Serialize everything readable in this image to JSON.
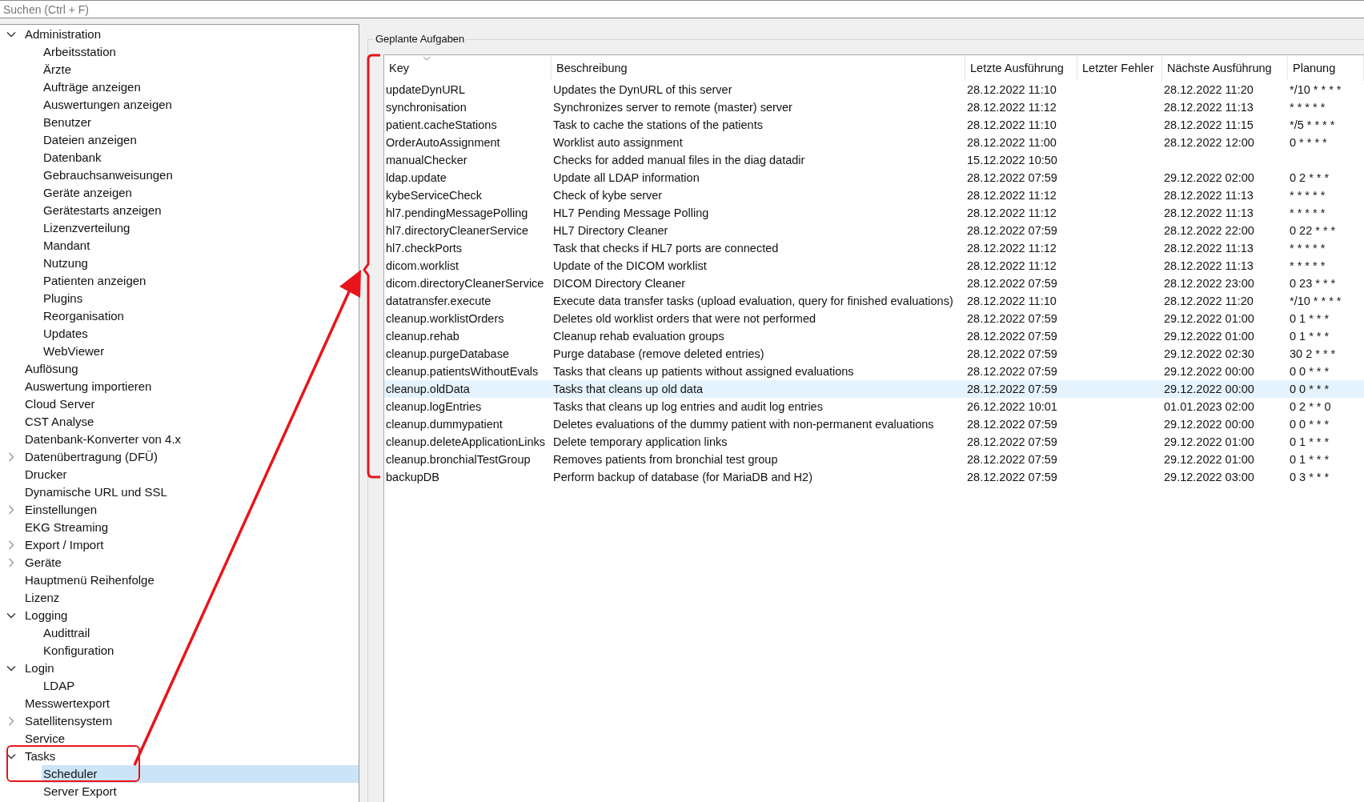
{
  "search": {
    "placeholder": "Suchen (Ctrl + F)"
  },
  "tree": [
    {
      "label": "Administration",
      "expanded": true,
      "selected": false,
      "children": [
        {
          "label": "Arbeitsstation",
          "selected": false
        },
        {
          "label": "Ärzte",
          "selected": false
        },
        {
          "label": "Aufträge anzeigen",
          "selected": false
        },
        {
          "label": "Auswertungen anzeigen",
          "selected": false
        },
        {
          "label": "Benutzer",
          "selected": false
        },
        {
          "label": "Dateien anzeigen",
          "selected": false
        },
        {
          "label": "Datenbank",
          "selected": false
        },
        {
          "label": "Gebrauchsanweisungen",
          "selected": false
        },
        {
          "label": "Geräte anzeigen",
          "selected": false
        },
        {
          "label": "Gerätestarts anzeigen",
          "selected": false
        },
        {
          "label": "Lizenzverteilung",
          "selected": false
        },
        {
          "label": "Mandant",
          "selected": false
        },
        {
          "label": "Nutzung",
          "selected": false
        },
        {
          "label": "Patienten anzeigen",
          "selected": false
        },
        {
          "label": "Plugins",
          "selected": false
        },
        {
          "label": "Reorganisation",
          "selected": false
        },
        {
          "label": "Updates",
          "selected": false
        },
        {
          "label": "WebViewer",
          "selected": false
        }
      ]
    },
    {
      "label": "Auflösung",
      "selected": false
    },
    {
      "label": "Auswertung importieren",
      "selected": false
    },
    {
      "label": "Cloud Server",
      "selected": false
    },
    {
      "label": "CST Analyse",
      "selected": false
    },
    {
      "label": "Datenbank-Konverter von 4.x",
      "selected": false
    },
    {
      "label": "Datenübertragung (DFÜ)",
      "expanded": false,
      "selected": false
    },
    {
      "label": "Drucker",
      "selected": false
    },
    {
      "label": "Dynamische URL und SSL",
      "selected": false
    },
    {
      "label": "Einstellungen",
      "expanded": false,
      "selected": false
    },
    {
      "label": "EKG Streaming",
      "selected": false
    },
    {
      "label": "Export / Import",
      "expanded": false,
      "selected": false
    },
    {
      "label": "Geräte",
      "expanded": false,
      "selected": false
    },
    {
      "label": "Hauptmenü Reihenfolge",
      "selected": false
    },
    {
      "label": "Lizenz",
      "selected": false
    },
    {
      "label": "Logging",
      "expanded": true,
      "selected": false,
      "children": [
        {
          "label": "Audittrail",
          "selected": false
        },
        {
          "label": "Konfiguration",
          "selected": false
        }
      ]
    },
    {
      "label": "Login",
      "expanded": true,
      "selected": false,
      "children": [
        {
          "label": "LDAP",
          "selected": false
        }
      ]
    },
    {
      "label": "Messwertexport",
      "selected": false
    },
    {
      "label": "Satellitensystem",
      "expanded": false,
      "selected": false
    },
    {
      "label": "Service",
      "selected": false
    },
    {
      "label": "Tasks",
      "expanded": true,
      "selected": false,
      "children": [
        {
          "label": "Scheduler",
          "selected": true
        },
        {
          "label": "Server Export",
          "selected": false
        }
      ]
    }
  ],
  "group": {
    "title": "Geplante Aufgaben"
  },
  "table": {
    "columns": [
      {
        "label": "Key",
        "sorted": true
      },
      {
        "label": "Beschreibung",
        "sorted": false
      },
      {
        "label": "Letzte Ausführung",
        "sorted": false
      },
      {
        "label": "Letzter Fehler",
        "sorted": false
      },
      {
        "label": "Nächste Ausführung",
        "sorted": false
      },
      {
        "label": "Planung",
        "sorted": false
      }
    ],
    "rows": [
      {
        "selected": false,
        "cells": [
          "updateDynURL",
          "Updates the DynURL of this server",
          "28.12.2022 11:10",
          "",
          "28.12.2022 11:20",
          "*/10 * * * *"
        ]
      },
      {
        "selected": false,
        "cells": [
          "synchronisation",
          "Synchronizes server to remote (master) server",
          "28.12.2022 11:12",
          "",
          "28.12.2022 11:13",
          "* * * * *"
        ]
      },
      {
        "selected": false,
        "cells": [
          "patient.cacheStations",
          "Task to cache the stations of the patients",
          "28.12.2022 11:10",
          "",
          "28.12.2022 11:15",
          "*/5 * * * *"
        ]
      },
      {
        "selected": false,
        "cells": [
          "OrderAutoAssignment",
          "Worklist auto assignment",
          "28.12.2022 11:00",
          "",
          "28.12.2022 12:00",
          "0 * * * *"
        ]
      },
      {
        "selected": false,
        "cells": [
          "manualChecker",
          "Checks for added manual files in the diag datadir",
          "15.12.2022 10:50",
          "",
          "",
          ""
        ]
      },
      {
        "selected": false,
        "cells": [
          "ldap.update",
          "Update all LDAP information",
          "28.12.2022 07:59",
          "",
          "29.12.2022 02:00",
          "0 2 * * *"
        ]
      },
      {
        "selected": false,
        "cells": [
          "kybeServiceCheck",
          "Check of kybe server",
          "28.12.2022 11:12",
          "",
          "28.12.2022 11:13",
          "* * * * *"
        ]
      },
      {
        "selected": false,
        "cells": [
          "hl7.pendingMessagePolling",
          "HL7 Pending Message Polling",
          "28.12.2022 11:12",
          "",
          "28.12.2022 11:13",
          "* * * * *"
        ]
      },
      {
        "selected": false,
        "cells": [
          "hl7.directoryCleanerService",
          "HL7 Directory Cleaner",
          "28.12.2022 07:59",
          "",
          "28.12.2022 22:00",
          "0 22 * * *"
        ]
      },
      {
        "selected": false,
        "cells": [
          "hl7.checkPorts",
          "Task that checks if HL7 ports are connected",
          "28.12.2022 11:12",
          "",
          "28.12.2022 11:13",
          "* * * * *"
        ]
      },
      {
        "selected": false,
        "cells": [
          "dicom.worklist",
          "Update of the DICOM worklist",
          "28.12.2022 11:12",
          "",
          "28.12.2022 11:13",
          "* * * * *"
        ]
      },
      {
        "selected": false,
        "cells": [
          "dicom.directoryCleanerService",
          "DICOM Directory Cleaner",
          "28.12.2022 07:59",
          "",
          "28.12.2022 23:00",
          "0 23 * * *"
        ]
      },
      {
        "selected": false,
        "cells": [
          "datatransfer.execute",
          "Execute data transfer tasks (upload evaluation, query for finished evaluations)",
          "28.12.2022 11:10",
          "",
          "28.12.2022 11:20",
          "*/10 * * * *"
        ]
      },
      {
        "selected": false,
        "cells": [
          "cleanup.worklistOrders",
          "Deletes old worklist orders that were not performed",
          "28.12.2022 07:59",
          "",
          "29.12.2022 01:00",
          "0 1 * * *"
        ]
      },
      {
        "selected": false,
        "cells": [
          "cleanup.rehab",
          "Cleanup rehab evaluation groups",
          "28.12.2022 07:59",
          "",
          "29.12.2022 01:00",
          "0 1 * * *"
        ]
      },
      {
        "selected": false,
        "cells": [
          "cleanup.purgeDatabase",
          "Purge database (remove deleted entries)",
          "28.12.2022 07:59",
          "",
          "29.12.2022 02:30",
          "30 2 * * *"
        ]
      },
      {
        "selected": false,
        "cells": [
          "cleanup.patientsWithoutEvals",
          "Tasks that cleans up patients without assigned evaluations",
          "28.12.2022 07:59",
          "",
          "29.12.2022 00:00",
          "0 0 * * *"
        ]
      },
      {
        "selected": true,
        "cells": [
          "cleanup.oldData",
          "Tasks that cleans up old data",
          "28.12.2022 07:59",
          "",
          "29.12.2022 00:00",
          "0 0 * * *"
        ]
      },
      {
        "selected": false,
        "cells": [
          "cleanup.logEntries",
          "Tasks that cleans up log entries and audit log entries",
          "26.12.2022 10:01",
          "",
          "01.01.2023 02:00",
          "0 2 * * 0"
        ]
      },
      {
        "selected": false,
        "cells": [
          "cleanup.dummypatient",
          "Deletes evaluations of the dummy patient with non-permanent evaluations",
          "28.12.2022 07:59",
          "",
          "29.12.2022 00:00",
          "0 0 * * *"
        ]
      },
      {
        "selected": false,
        "cells": [
          "cleanup.deleteApplicationLinks",
          "Delete temporary application links",
          "28.12.2022 07:59",
          "",
          "29.12.2022 01:00",
          "0 1 * * *"
        ]
      },
      {
        "selected": false,
        "cells": [
          "cleanup.bronchialTestGroup",
          "Removes patients from bronchial test group",
          "28.12.2022 07:59",
          "",
          "29.12.2022 01:00",
          "0 1 * * *"
        ]
      },
      {
        "selected": false,
        "cells": [
          "backupDB",
          "Perform backup of database (for MariaDB and H2)",
          "28.12.2022 07:59",
          "",
          "29.12.2022 03:00",
          "0 3 * * *"
        ]
      }
    ]
  },
  "annotations": [
    {
      "kind": "bracket"
    },
    {
      "kind": "arrow"
    },
    {
      "kind": "box"
    }
  ]
}
